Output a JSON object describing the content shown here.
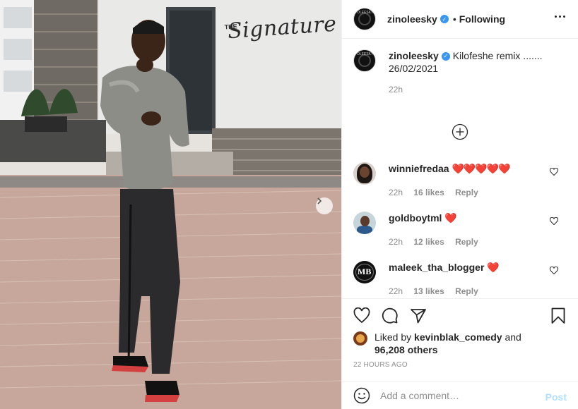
{
  "photo": {
    "sign_prefix": "THE",
    "sign_word": "Signature",
    "next_icon": "chevron-right-icon"
  },
  "header": {
    "username": "zinoleesky",
    "avatar_text": "OLEESKY",
    "separator": "•",
    "follow_status": "Following",
    "more_icon": "more-horizontal-icon"
  },
  "caption": {
    "username": "zinoleesky",
    "text": "Kilofeshe remix ....... 26/02/2021",
    "time": "22h"
  },
  "load_more_icon": "plus-circle-icon",
  "comments": [
    {
      "username": "winniefredaa",
      "text": "❤️❤️❤️❤️❤️",
      "time": "22h",
      "likes": "16 likes",
      "reply": "Reply"
    },
    {
      "username": "goldboytml",
      "text": "❤️",
      "time": "22h",
      "likes": "12 likes",
      "reply": "Reply"
    },
    {
      "username": "maleek_tha_blogger",
      "avatar_text": "MB",
      "text": "❤️",
      "time": "22h",
      "likes": "13 likes",
      "reply": "Reply"
    }
  ],
  "likes": {
    "prefix": "Liked by",
    "user": "kevinblak_comedy",
    "and": "and",
    "others": "96,208 others"
  },
  "timestamp": "22 HOURS AGO",
  "add_comment": {
    "placeholder": "Add a comment…",
    "post_label": "Post"
  },
  "colors": {
    "verified": "#3897f0",
    "heart": "#ed4956",
    "post_disabled": "#b2dffc",
    "meta_grey": "#8e8e8e"
  }
}
